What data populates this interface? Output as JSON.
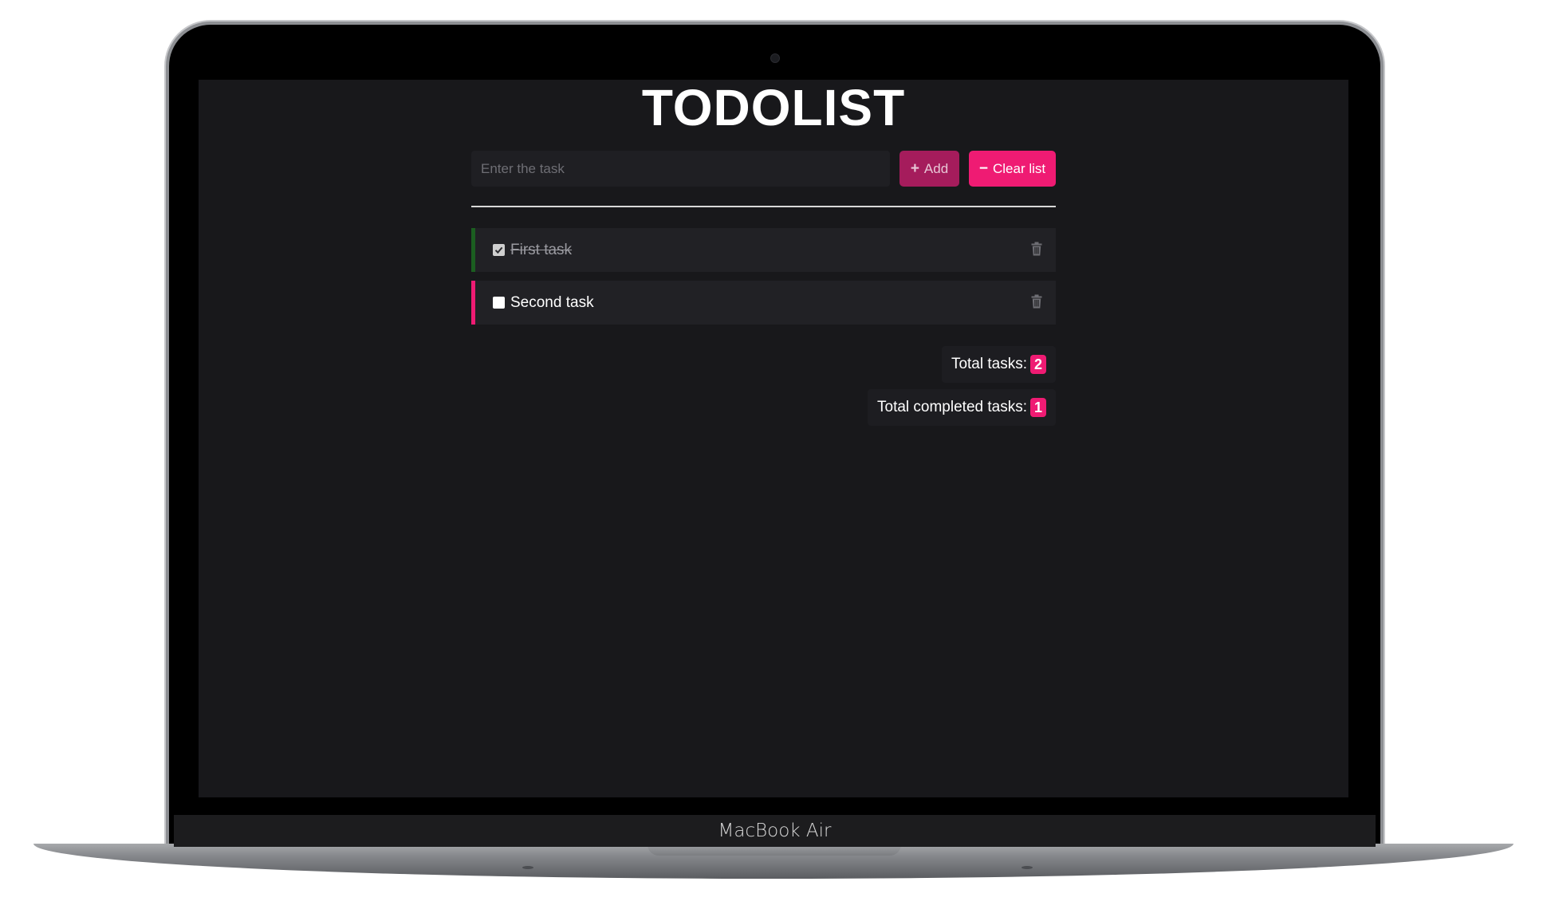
{
  "app": {
    "title": "TODOLIST"
  },
  "input": {
    "placeholder": "Enter the task",
    "value": ""
  },
  "buttons": {
    "add": {
      "symbol": "+",
      "label": "Add"
    },
    "clear": {
      "symbol": "−",
      "label": "Clear list"
    }
  },
  "tasks": [
    {
      "text": "First task",
      "completed": true
    },
    {
      "text": "Second task",
      "completed": false
    }
  ],
  "stats": {
    "total_label": "Total tasks:",
    "total_value": "2",
    "completed_label": "Total completed tasks:",
    "completed_value": "1"
  },
  "device": {
    "brand_label": "MacBook Air"
  },
  "colors": {
    "accent": "#ef1b73",
    "add_button": "#a51c5c",
    "done_marker": "#1b5e20",
    "background": "#18181b"
  }
}
